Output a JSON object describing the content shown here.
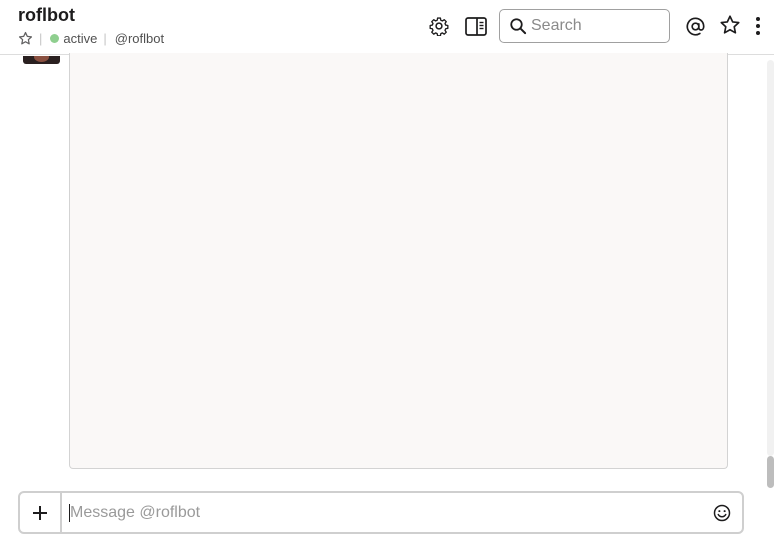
{
  "header": {
    "title": "roflbot",
    "status_text": "active",
    "handle": "@roflbot",
    "separator": "|"
  },
  "search": {
    "placeholder": "Search"
  },
  "composer": {
    "placeholder": "Message @roflbot"
  },
  "icons": {
    "star_small": "star-outline-icon",
    "settings": "gear-icon",
    "details": "sidebar-panel-icon",
    "search": "search-icon",
    "mention": "at-sign-icon",
    "starred": "star-outline-icon",
    "more": "vertical-ellipsis-icon",
    "attach": "plus-icon",
    "emoji": "emoji-icon"
  },
  "colors": {
    "presence_active": "#8fcf8f",
    "border": "#cfcfcf",
    "preview_bg": "#faf8f7"
  }
}
